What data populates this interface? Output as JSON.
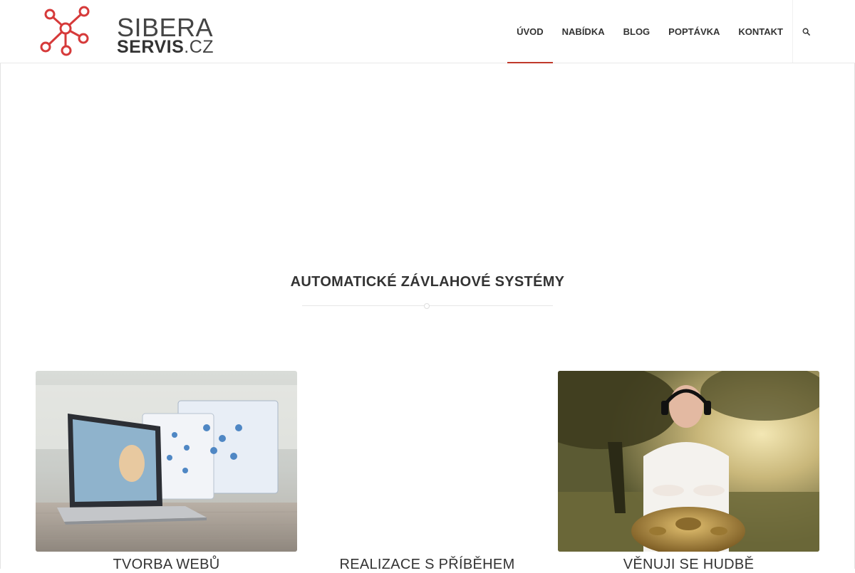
{
  "logo": {
    "line1": "SIBERA",
    "line2": "SERVIS",
    "tld": ".CZ"
  },
  "nav": {
    "items": [
      {
        "label": "ÚVOD",
        "active": true
      },
      {
        "label": "NABÍDKA",
        "active": false
      },
      {
        "label": "BLOG",
        "active": false
      },
      {
        "label": "POPTÁVKA",
        "active": false
      },
      {
        "label": "KONTAKT",
        "active": false
      }
    ],
    "search_icon": "search-icon"
  },
  "main": {
    "section_title": "AUTOMATICKÉ ZÁVLAHOVÉ SYSTÉMY",
    "cards": [
      {
        "title": "TVORBA WEBŮ",
        "image": "laptop-web-design-photo"
      },
      {
        "title": "REALIZACE S PŘÍBĚHEM",
        "image": ""
      },
      {
        "title": "VĚNUJI SE HUDBĚ",
        "image": "handpan-musician-photo"
      }
    ]
  },
  "colors": {
    "accent": "#c0392b",
    "text": "#333333",
    "divider": "#e6e6e6"
  }
}
